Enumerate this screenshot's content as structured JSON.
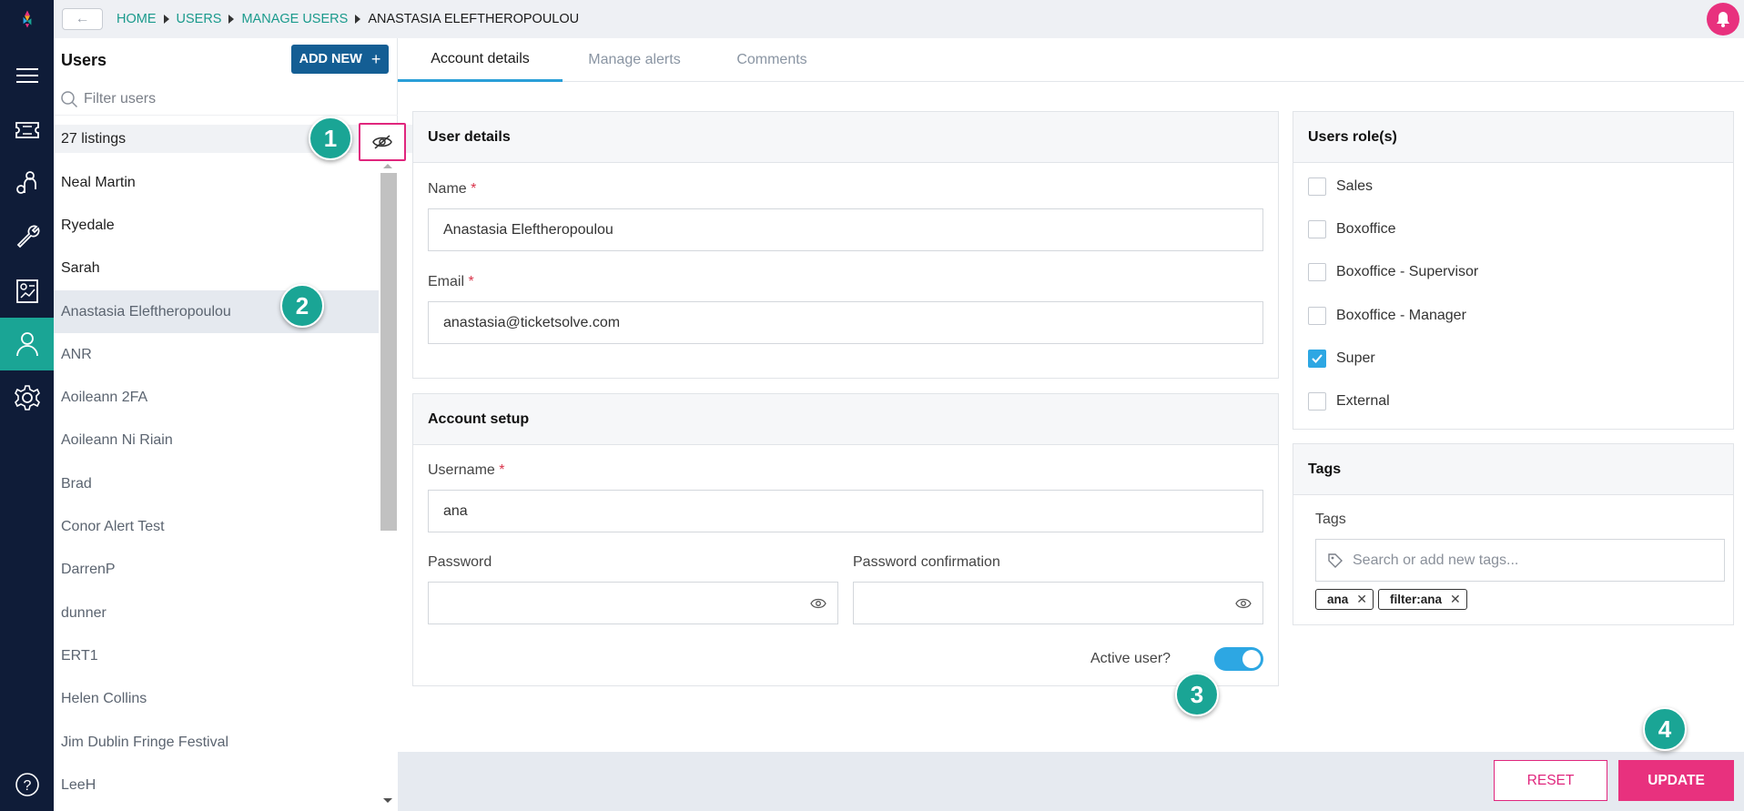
{
  "topbar": {
    "back_icon": "arrow-left-icon",
    "breadcrumb": [
      "HOME",
      "USERS",
      "MANAGE USERS",
      "ANASTASIA ELEFTHEROPOULOU"
    ],
    "notification_icon": "bell-icon"
  },
  "rail": {
    "items": [
      "logo-icon",
      "menu-icon",
      "ticket-icon",
      "customers-icon",
      "tools-icon",
      "reports-icon",
      "user-icon",
      "settings-icon"
    ],
    "help_icon": "help-icon",
    "active": "user-icon"
  },
  "sidebar": {
    "title": "Users",
    "add_new_label": "ADD NEW",
    "add_new_icon": "plus-icon",
    "filter_placeholder": "Filter users",
    "listing_count": "27 listings",
    "hide_toggle_icon": "eye-off-icon",
    "users": [
      "Neal Martin",
      "Ryedale",
      "Sarah",
      "Anastasia Eleftheropoulou",
      "ANR",
      "Aoileann 2FA",
      "Aoileann Ni Riain",
      "Brad",
      "Conor Alert Test",
      "DarrenP",
      "dunner",
      "ERT1",
      "Helen Collins",
      "Jim Dublin Fringe Festival",
      "LeeH"
    ],
    "selected_user": "Anastasia Eleftheropoulou"
  },
  "tabs": [
    "Account details",
    "Manage alerts",
    "Comments"
  ],
  "active_tab": "Account details",
  "user_details": {
    "title": "User details",
    "name_label": "Name",
    "name_value": "Anastasia Eleftheropoulou",
    "email_label": "Email",
    "email_value": "anastasia@ticketsolve.com",
    "required_mark": "*"
  },
  "account_setup": {
    "title": "Account setup",
    "username_label": "Username",
    "username_value": "ana",
    "password_label": "Password",
    "password_confirm_label": "Password confirmation",
    "active_label": "Active user?",
    "active": true
  },
  "roles": {
    "title": "Users role(s)",
    "items": [
      {
        "label": "Sales",
        "checked": false
      },
      {
        "label": "Boxoffice",
        "checked": false
      },
      {
        "label": "Boxoffice - Supervisor",
        "checked": false
      },
      {
        "label": "Boxoffice - Manager",
        "checked": false
      },
      {
        "label": "Super",
        "checked": true
      },
      {
        "label": "External",
        "checked": false
      }
    ]
  },
  "tags": {
    "title": "Tags",
    "field_label": "Tags",
    "placeholder": "Search or add new tags...",
    "tag_icon": "tag-icon",
    "items": [
      "ana",
      "filter:ana"
    ]
  },
  "footer": {
    "reset_label": "RESET",
    "update_label": "UPDATE"
  },
  "step_markers": [
    "1",
    "2",
    "3",
    "4"
  ],
  "colors": {
    "rail_bg": "#0f1c38",
    "accent_teal": "#1aa595",
    "primary_blue": "#145e94",
    "toggle_blue": "#2da7e3",
    "pink": "#e8317e"
  }
}
